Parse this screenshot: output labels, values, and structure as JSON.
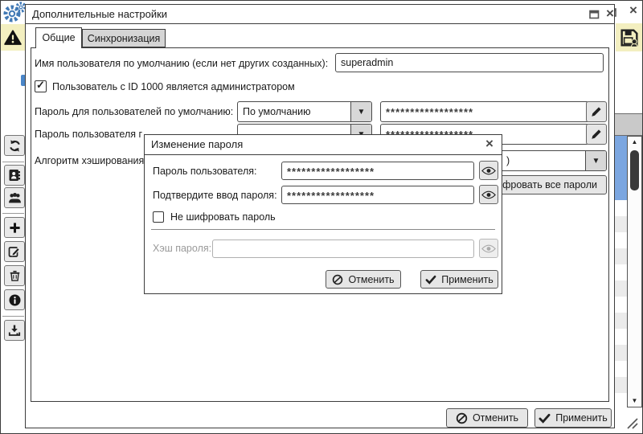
{
  "icons": {
    "close_glyph": "×",
    "scroll_up": "▲",
    "scroll_down": "▼",
    "combo_arrow": "▼",
    "checkbox_check": "✓"
  },
  "settings_dialog": {
    "title": "Дополнительные настройки",
    "tabs": [
      {
        "label": "Общие"
      },
      {
        "label": "Синхронизация"
      }
    ],
    "username_label": "Имя пользователя по умолчанию (если нет других созданных):",
    "username_value": "superadmin",
    "admin_checkbox_label": "Пользователь с ID 1000 является администратором",
    "default_password_label": "Пароль для пользователей по умолчанию:",
    "default_password_combo_value": "По умолчанию",
    "default_password_masked": "******************",
    "user_password_label_visible": "Пароль пользователя г",
    "user_password_masked": "******************",
    "hash_algorithm_label_visible": "Алгоритм хэширования",
    "hash_algorithm_combo_visible": ")",
    "encrypt_all_button_visible": "ифровать все пароли",
    "cancel_label": "Отменить",
    "apply_label": "Применить"
  },
  "password_dialog": {
    "title": "Изменение пароля",
    "password_label": "Пароль пользователя:",
    "password_masked": "******************",
    "confirm_label": "Подтвердите ввод пароля:",
    "confirm_masked": "******************",
    "plain_checkbox_label": "Не шифровать пароль",
    "hash_label": "Хэш пароля:",
    "hash_value": "",
    "cancel_label": "Отменить",
    "apply_label": "Применить"
  }
}
